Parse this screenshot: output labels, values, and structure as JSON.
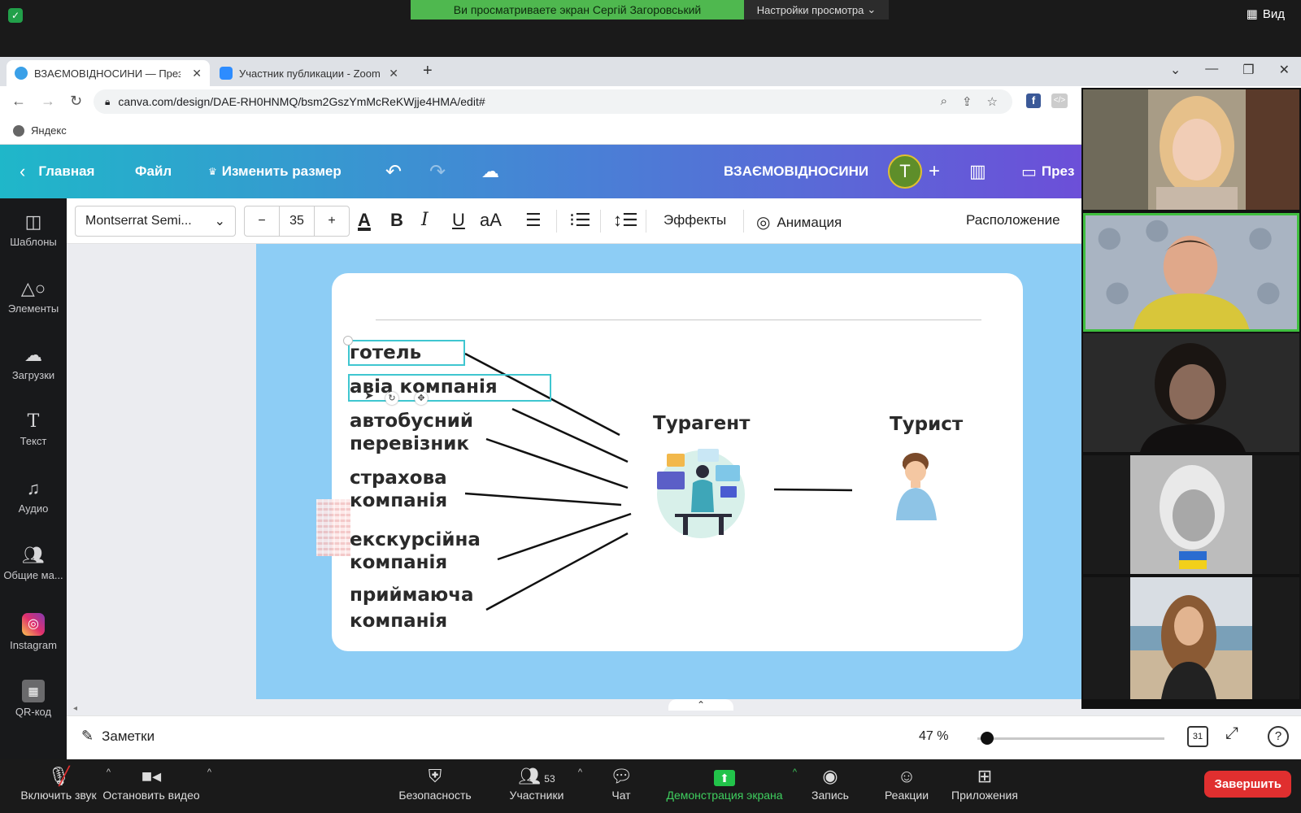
{
  "zoom_top": {
    "share_notice": "Ви просматриваете экран Сергій Загоровський",
    "view_settings": "Настройки просмотра",
    "view_button": "Вид"
  },
  "browser": {
    "tabs": [
      {
        "title": "ВЗАЄМОВІДНОСИНИ — Презен"
      },
      {
        "title": "Участник публикации - Zoom"
      }
    ],
    "url": "canva.com/design/DAE-RH0HNMQ/bsm2GszYmMcReKWjje4HMA/edit#",
    "bookmark": "Яндекс"
  },
  "canva_header": {
    "home": "Главная",
    "file": "Файл",
    "resize": "Изменить размер",
    "design_title": "ВЗАЄМОВІДНОСИНИ",
    "avatar_letter": "T",
    "present": "През"
  },
  "toolbar": {
    "font": "Montserrat Semi...",
    "minus": "−",
    "size": "35",
    "plus": "+",
    "effects": "Эффекты",
    "animation": "Анимация",
    "position": "Расположение"
  },
  "sidebar": [
    {
      "label": "Шаблоны"
    },
    {
      "label": "Элементы"
    },
    {
      "label": "Загрузки"
    },
    {
      "label": "Текст"
    },
    {
      "label": "Аудио"
    },
    {
      "label": "Общие ма..."
    },
    {
      "label": "Instagram"
    },
    {
      "label": "QR-код"
    }
  ],
  "slide": {
    "providers": [
      {
        "line1": "готель",
        "line2": ""
      },
      {
        "line1": "авіа компанія",
        "line2": ""
      },
      {
        "line1": "автобусний",
        "line2": "перевізник"
      },
      {
        "line1": "страхова",
        "line2": "компанія"
      },
      {
        "line1": "екскурсійна",
        "line2": "компанія"
      },
      {
        "line1": "приймаюча",
        "line2": "компанія"
      }
    ],
    "agent": "Турагент",
    "tourist": "Турист"
  },
  "canva_bottom": {
    "notes": "Заметки",
    "zoom": "47 %",
    "zoom_fraction": 0.05,
    "page_count": "31"
  },
  "zoom_bar": {
    "unmute": "Включить звук",
    "stop_video": "Остановить видео",
    "security": "Безопасность",
    "participants": "Участники",
    "participants_count": "53",
    "chat": "Чат",
    "share": "Демонстрация экрана",
    "record": "Запись",
    "reactions": "Реакции",
    "apps": "Приложения",
    "end": "Завершить"
  },
  "colors": {
    "share_green": "#4fb84f",
    "end_red": "#e02f2f",
    "slide_blue": "#8dcdf5",
    "selection": "#3fc6d0",
    "active_speaker": "#3fbf3f"
  }
}
